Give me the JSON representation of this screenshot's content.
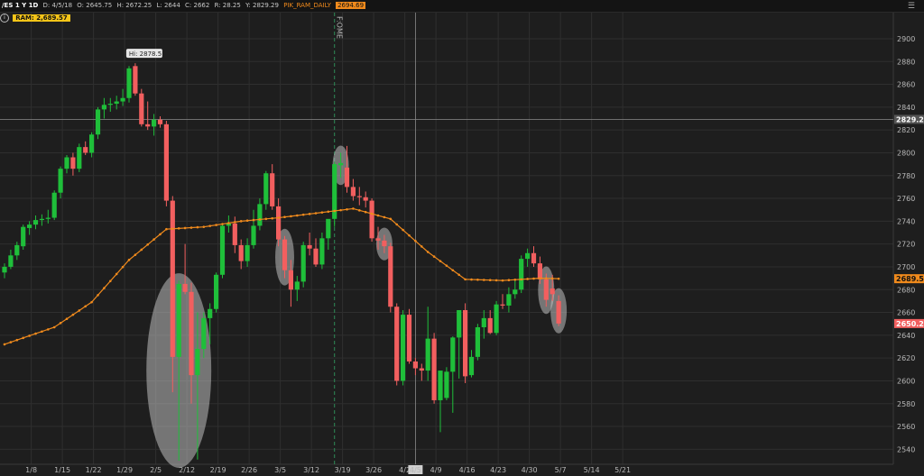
{
  "header": {
    "symbol": "/ES 1 Y 1D",
    "date": "D: 4/5/18",
    "open": "O: 2645.75",
    "high": "H: 2672.25",
    "low": "L: 2644",
    "close": "C: 2662",
    "range": "R: 28.25",
    "y": "Y: 2829.29",
    "study_name": "PIK_RAM_DAILY",
    "study_value": "2694.69",
    "ram_label": "RAM: 2,689.57",
    "info_icon": "info-icon",
    "settings_icon": "settings-icon"
  },
  "chart_data": {
    "type": "candlestick",
    "ylim": [
      2525,
      2910
    ],
    "y_ticks": [
      2540,
      2560,
      2580,
      2600,
      2620,
      2640,
      2660,
      2680,
      2700,
      2720,
      2740,
      2760,
      2780,
      2800,
      2820,
      2840,
      2860,
      2880,
      2900
    ],
    "x_ticks": [
      "1/8",
      "1/15",
      "1/22",
      "1/29",
      "2/5",
      "2/12",
      "2/19",
      "2/26",
      "3/5",
      "3/12",
      "3/19",
      "3/26",
      "4/2",
      "4/9",
      "4/16",
      "4/23",
      "4/30",
      "5/7",
      "5/14",
      "5/21"
    ],
    "first_date": "1/2",
    "candles": [
      {
        "o": 2695,
        "h": 2703,
        "l": 2690,
        "c": 2700
      },
      {
        "o": 2700,
        "h": 2715,
        "l": 2698,
        "c": 2710
      },
      {
        "o": 2710,
        "h": 2722,
        "l": 2706,
        "c": 2719
      },
      {
        "o": 2718,
        "h": 2737,
        "l": 2715,
        "c": 2735
      },
      {
        "o": 2734,
        "h": 2740,
        "l": 2728,
        "c": 2737
      },
      {
        "o": 2737,
        "h": 2745,
        "l": 2733,
        "c": 2741
      },
      {
        "o": 2741,
        "h": 2746,
        "l": 2736,
        "c": 2742
      },
      {
        "o": 2742,
        "h": 2750,
        "l": 2738,
        "c": 2743
      },
      {
        "o": 2743,
        "h": 2767,
        "l": 2741,
        "c": 2765
      },
      {
        "o": 2765,
        "h": 2788,
        "l": 2760,
        "c": 2786
      },
      {
        "o": 2786,
        "h": 2798,
        "l": 2782,
        "c": 2796
      },
      {
        "o": 2796,
        "h": 2800,
        "l": 2780,
        "c": 2786
      },
      {
        "o": 2786,
        "h": 2808,
        "l": 2783,
        "c": 2805
      },
      {
        "o": 2805,
        "h": 2810,
        "l": 2798,
        "c": 2800
      },
      {
        "o": 2800,
        "h": 2818,
        "l": 2796,
        "c": 2816
      },
      {
        "o": 2816,
        "h": 2840,
        "l": 2812,
        "c": 2838
      },
      {
        "o": 2838,
        "h": 2848,
        "l": 2830,
        "c": 2842
      },
      {
        "o": 2842,
        "h": 2848,
        "l": 2836,
        "c": 2843
      },
      {
        "o": 2843,
        "h": 2850,
        "l": 2838,
        "c": 2845
      },
      {
        "o": 2845,
        "h": 2856,
        "l": 2841,
        "c": 2848
      },
      {
        "o": 2848,
        "h": 2876,
        "l": 2844,
        "c": 2874
      },
      {
        "o": 2876,
        "h": 2878.5,
        "l": 2850,
        "c": 2852
      },
      {
        "o": 2852,
        "h": 2856,
        "l": 2823,
        "c": 2825
      },
      {
        "o": 2825,
        "h": 2845,
        "l": 2820,
        "c": 2823
      },
      {
        "o": 2823,
        "h": 2834,
        "l": 2815,
        "c": 2829
      },
      {
        "o": 2829,
        "h": 2832,
        "l": 2822,
        "c": 2825
      },
      {
        "o": 2825,
        "h": 2828,
        "l": 2753,
        "c": 2758
      },
      {
        "o": 2758,
        "h": 2762,
        "l": 2590,
        "c": 2621
      },
      {
        "o": 2621,
        "h": 2688,
        "l": 2530,
        "c": 2685
      },
      {
        "o": 2685,
        "h": 2720,
        "l": 2676,
        "c": 2678
      },
      {
        "o": 2678,
        "h": 2686,
        "l": 2580,
        "c": 2605
      },
      {
        "o": 2605,
        "h": 2660,
        "l": 2531,
        "c": 2628
      },
      {
        "o": 2628,
        "h": 2660,
        "l": 2620,
        "c": 2655
      },
      {
        "o": 2655,
        "h": 2668,
        "l": 2632,
        "c": 2663
      },
      {
        "o": 2663,
        "h": 2695,
        "l": 2660,
        "c": 2693
      },
      {
        "o": 2693,
        "h": 2738,
        "l": 2690,
        "c": 2736
      },
      {
        "o": 2736,
        "h": 2745,
        "l": 2730,
        "c": 2738
      },
      {
        "o": 2738,
        "h": 2744,
        "l": 2712,
        "c": 2719
      },
      {
        "o": 2719,
        "h": 2724,
        "l": 2698,
        "c": 2705
      },
      {
        "o": 2705,
        "h": 2725,
        "l": 2700,
        "c": 2719
      },
      {
        "o": 2719,
        "h": 2750,
        "l": 2716,
        "c": 2736
      },
      {
        "o": 2736,
        "h": 2760,
        "l": 2732,
        "c": 2755
      },
      {
        "o": 2755,
        "h": 2784,
        "l": 2750,
        "c": 2782
      },
      {
        "o": 2782,
        "h": 2790,
        "l": 2750,
        "c": 2753
      },
      {
        "o": 2753,
        "h": 2760,
        "l": 2718,
        "c": 2724
      },
      {
        "o": 2724,
        "h": 2727,
        "l": 2690,
        "c": 2697
      },
      {
        "o": 2697,
        "h": 2706,
        "l": 2665,
        "c": 2680
      },
      {
        "o": 2680,
        "h": 2692,
        "l": 2670,
        "c": 2687
      },
      {
        "o": 2687,
        "h": 2722,
        "l": 2682,
        "c": 2719
      },
      {
        "o": 2719,
        "h": 2730,
        "l": 2710,
        "c": 2716
      },
      {
        "o": 2716,
        "h": 2725,
        "l": 2700,
        "c": 2702
      },
      {
        "o": 2702,
        "h": 2730,
        "l": 2698,
        "c": 2725
      },
      {
        "o": 2725,
        "h": 2740,
        "l": 2715,
        "c": 2742
      },
      {
        "o": 2742,
        "h": 2792,
        "l": 2735,
        "c": 2790
      },
      {
        "o": 2789,
        "h": 2800,
        "l": 2778,
        "c": 2791
      },
      {
        "o": 2787,
        "h": 2806,
        "l": 2765,
        "c": 2770
      },
      {
        "o": 2770,
        "h": 2777,
        "l": 2758,
        "c": 2762
      },
      {
        "o": 2762,
        "h": 2770,
        "l": 2754,
        "c": 2761
      },
      {
        "o": 2761,
        "h": 2766,
        "l": 2752,
        "c": 2758
      },
      {
        "o": 2758,
        "h": 2760,
        "l": 2722,
        "c": 2725
      },
      {
        "o": 2725,
        "h": 2735,
        "l": 2715,
        "c": 2723
      },
      {
        "o": 2723,
        "h": 2728,
        "l": 2712,
        "c": 2718
      },
      {
        "o": 2718,
        "h": 2721,
        "l": 2660,
        "c": 2665
      },
      {
        "o": 2665,
        "h": 2668,
        "l": 2596,
        "c": 2600
      },
      {
        "o": 2600,
        "h": 2662,
        "l": 2596,
        "c": 2658
      },
      {
        "o": 2658,
        "h": 2663,
        "l": 2615,
        "c": 2617
      },
      {
        "o": 2617,
        "h": 2620,
        "l": 2605,
        "c": 2611
      },
      {
        "o": 2611,
        "h": 2615,
        "l": 2600,
        "c": 2609
      },
      {
        "o": 2609,
        "h": 2665,
        "l": 2600,
        "c": 2637
      },
      {
        "o": 2637,
        "h": 2642,
        "l": 2580,
        "c": 2583
      },
      {
        "o": 2583,
        "h": 2590,
        "l": 2555,
        "c": 2609
      },
      {
        "o": 2585,
        "h": 2612,
        "l": 2583,
        "c": 2608
      },
      {
        "o": 2608,
        "h": 2639,
        "l": 2572,
        "c": 2638
      },
      {
        "o": 2638,
        "h": 2662,
        "l": 2602,
        "c": 2662
      },
      {
        "o": 2662,
        "h": 2668,
        "l": 2598,
        "c": 2604
      },
      {
        "o": 2605,
        "h": 2627,
        "l": 2603,
        "c": 2621
      },
      {
        "o": 2621,
        "h": 2650,
        "l": 2618,
        "c": 2647
      },
      {
        "o": 2647,
        "h": 2662,
        "l": 2637,
        "c": 2655
      },
      {
        "o": 2655,
        "h": 2662,
        "l": 2641,
        "c": 2642
      },
      {
        "o": 2642,
        "h": 2670,
        "l": 2640,
        "c": 2667
      },
      {
        "o": 2667,
        "h": 2676,
        "l": 2663,
        "c": 2666
      },
      {
        "o": 2666,
        "h": 2682,
        "l": 2660,
        "c": 2676
      },
      {
        "o": 2676,
        "h": 2688,
        "l": 2672,
        "c": 2680
      },
      {
        "o": 2680,
        "h": 2710,
        "l": 2677,
        "c": 2707
      },
      {
        "o": 2707,
        "h": 2716,
        "l": 2700,
        "c": 2712
      },
      {
        "o": 2712,
        "h": 2718,
        "l": 2700,
        "c": 2703
      },
      {
        "o": 2703,
        "h": 2709,
        "l": 2685,
        "c": 2689
      },
      {
        "o": 2689,
        "h": 2694,
        "l": 2665,
        "c": 2671
      },
      {
        "o": 2681,
        "h": 2693,
        "l": 2670,
        "c": 2676
      },
      {
        "o": 2670,
        "h": 2675,
        "l": 2648,
        "c": 2650.25
      }
    ],
    "ram_study": {
      "name": "PIK_RAM_DAILY",
      "x_index": [
        0,
        8,
        14,
        20,
        26,
        32,
        38,
        44,
        50,
        56,
        62,
        68,
        74,
        80,
        86,
        89
      ],
      "values": [
        2632,
        2647,
        2669,
        2706,
        2733,
        2735,
        2740,
        2743,
        2747,
        2751,
        2742,
        2713,
        2689,
        2688,
        2690,
        2689.57
      ]
    },
    "hi_label": "Hi: 2878.5",
    "hi_index": 21,
    "current_price": "2650.25",
    "ram_price": "2689.57",
    "crosshair_price": "2829.29",
    "crosshair_date": "4/5",
    "crosshair_index": 66,
    "event_label": "F:OME",
    "event_index": 53,
    "highlight_ellipses": [
      {
        "index": 28,
        "low": 2612,
        "high": 2632
      },
      {
        "index": 45,
        "low": 2686,
        "high": 2700
      },
      {
        "index": 54,
        "low": 2786,
        "high": 2792
      },
      {
        "index": 61,
        "low": 2698,
        "high": 2725
      },
      {
        "index": 87,
        "low": 2704,
        "high": 2710
      },
      {
        "index": 89,
        "low": 2672,
        "high": 2678
      }
    ],
    "colors": {
      "up": "#1fbf3a",
      "down": "#f25f5f",
      "ram": "#f08a1c",
      "grid": "#2f2f2f",
      "crosshair": "#8a8a8a",
      "event": "#2e8b57"
    }
  }
}
